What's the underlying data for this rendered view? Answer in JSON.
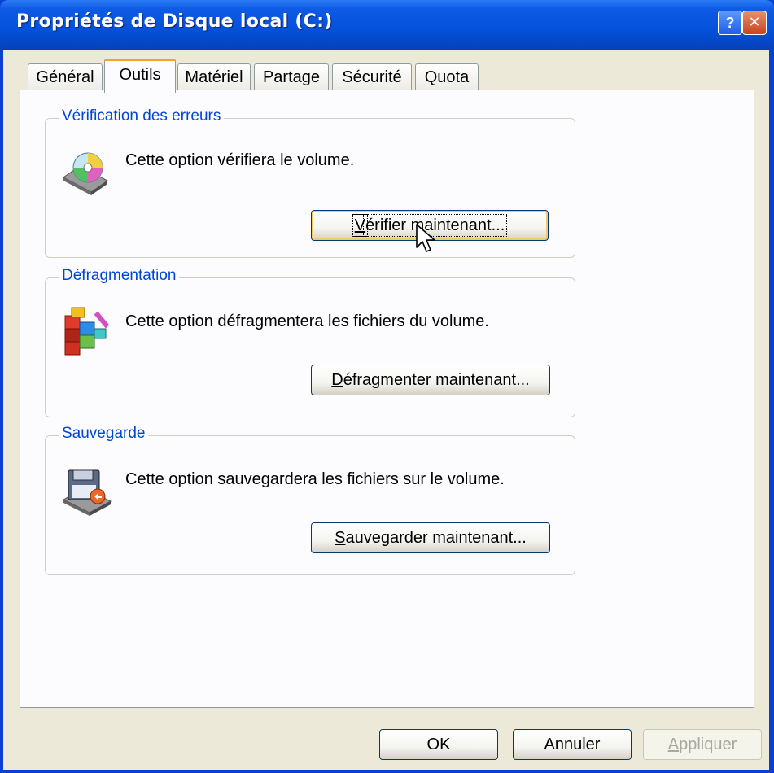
{
  "window": {
    "title": "Propriétés de Disque local (C:)",
    "help_glyph": "?",
    "close_glyph": "✕"
  },
  "tabs": [
    {
      "label": "Général",
      "active": false
    },
    {
      "label": "Outils",
      "active": true
    },
    {
      "label": "Matériel",
      "active": false
    },
    {
      "label": "Partage",
      "active": false
    },
    {
      "label": "Sécurité",
      "active": false
    },
    {
      "label": "Quota",
      "active": false
    }
  ],
  "groups": {
    "check": {
      "label": "Vérification des erreurs",
      "text": "Cette option vérifiera le volume.",
      "button_ul": "V",
      "button_rest": "érifier maintenant..."
    },
    "defrag": {
      "label": "Défragmentation",
      "text": "Cette option défragmentera les fichiers du volume.",
      "button_ul": "D",
      "button_rest": "éfragmenter maintenant..."
    },
    "backup": {
      "label": "Sauvegarde",
      "text": "Cette option sauvegardera les fichiers sur le volume.",
      "button_ul": "S",
      "button_rest": "auvegarder maintenant..."
    }
  },
  "footer": {
    "ok": "OK",
    "cancel": "Annuler",
    "apply_ul": "A",
    "apply_rest": "ppliquer"
  },
  "colors": {
    "title_blue": "#0552dd",
    "dialog_bg": "#ece9d8",
    "group_label": "#0046d5",
    "tab_active_accent": "#f5a327"
  }
}
